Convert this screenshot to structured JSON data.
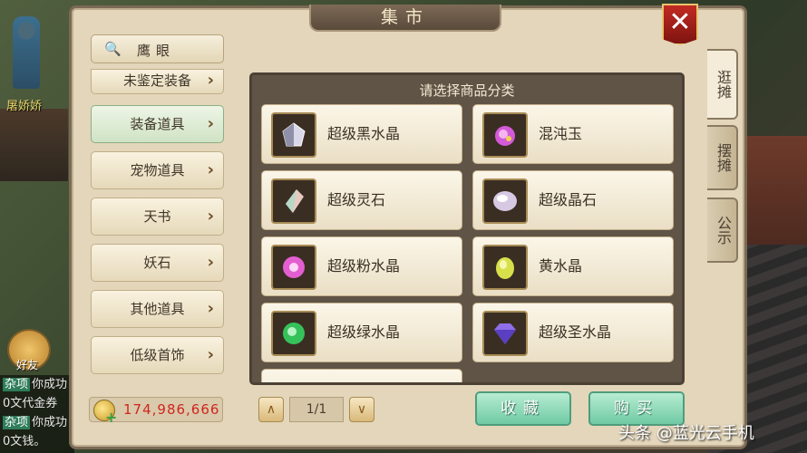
{
  "background": {
    "npc_name": "屠娇娇",
    "friend_label": "好友",
    "chat": [
      {
        "tag": "杂项",
        "text": "你成功"
      },
      {
        "tag": "",
        "text": "0文代金券"
      },
      {
        "tag": "杂项",
        "text": "你成功"
      },
      {
        "tag": "",
        "text": "0文钱。"
      }
    ]
  },
  "dialog": {
    "title": "集市",
    "close_label": "✕",
    "search": {
      "icon": "search-icon",
      "label": "鹰眼"
    },
    "categories": [
      {
        "label": "未鉴定装备",
        "active": false
      },
      {
        "label": "装备道具",
        "active": true
      },
      {
        "label": "宠物道具",
        "active": false
      },
      {
        "label": "天书",
        "active": false
      },
      {
        "label": "妖石",
        "active": false
      },
      {
        "label": "其他道具",
        "active": false
      },
      {
        "label": "低级首饰",
        "active": false
      }
    ],
    "currency": {
      "icon": "coin-add-icon",
      "value": "174,986,666"
    },
    "goods": {
      "header": "请选择商品分类",
      "items": [
        {
          "name": "超级黑水晶",
          "color": "#d8d8e8"
        },
        {
          "name": "混沌玉",
          "color": "#d35ad8"
        },
        {
          "name": "超级灵石",
          "color": "#e8c9c0"
        },
        {
          "name": "超级晶石",
          "color": "#d7c8e4"
        },
        {
          "name": "超级粉水晶",
          "color": "#e35fd1"
        },
        {
          "name": "黄水晶",
          "color": "#d7e04a"
        },
        {
          "name": "超级绿水晶",
          "color": "#36c25a"
        },
        {
          "name": "超级圣水晶",
          "color": "#8f6ee8"
        }
      ]
    },
    "pager": {
      "prev": "∧",
      "page": "1/1",
      "next": "∨"
    },
    "buttons": {
      "favorite": "收藏",
      "buy": "购买"
    },
    "side_tabs": [
      {
        "label": "逛摊",
        "active": true
      },
      {
        "label": "摆摊",
        "active": false
      },
      {
        "label": "公示",
        "active": false
      }
    ]
  },
  "watermark": "头条 @蓝光云手机"
}
